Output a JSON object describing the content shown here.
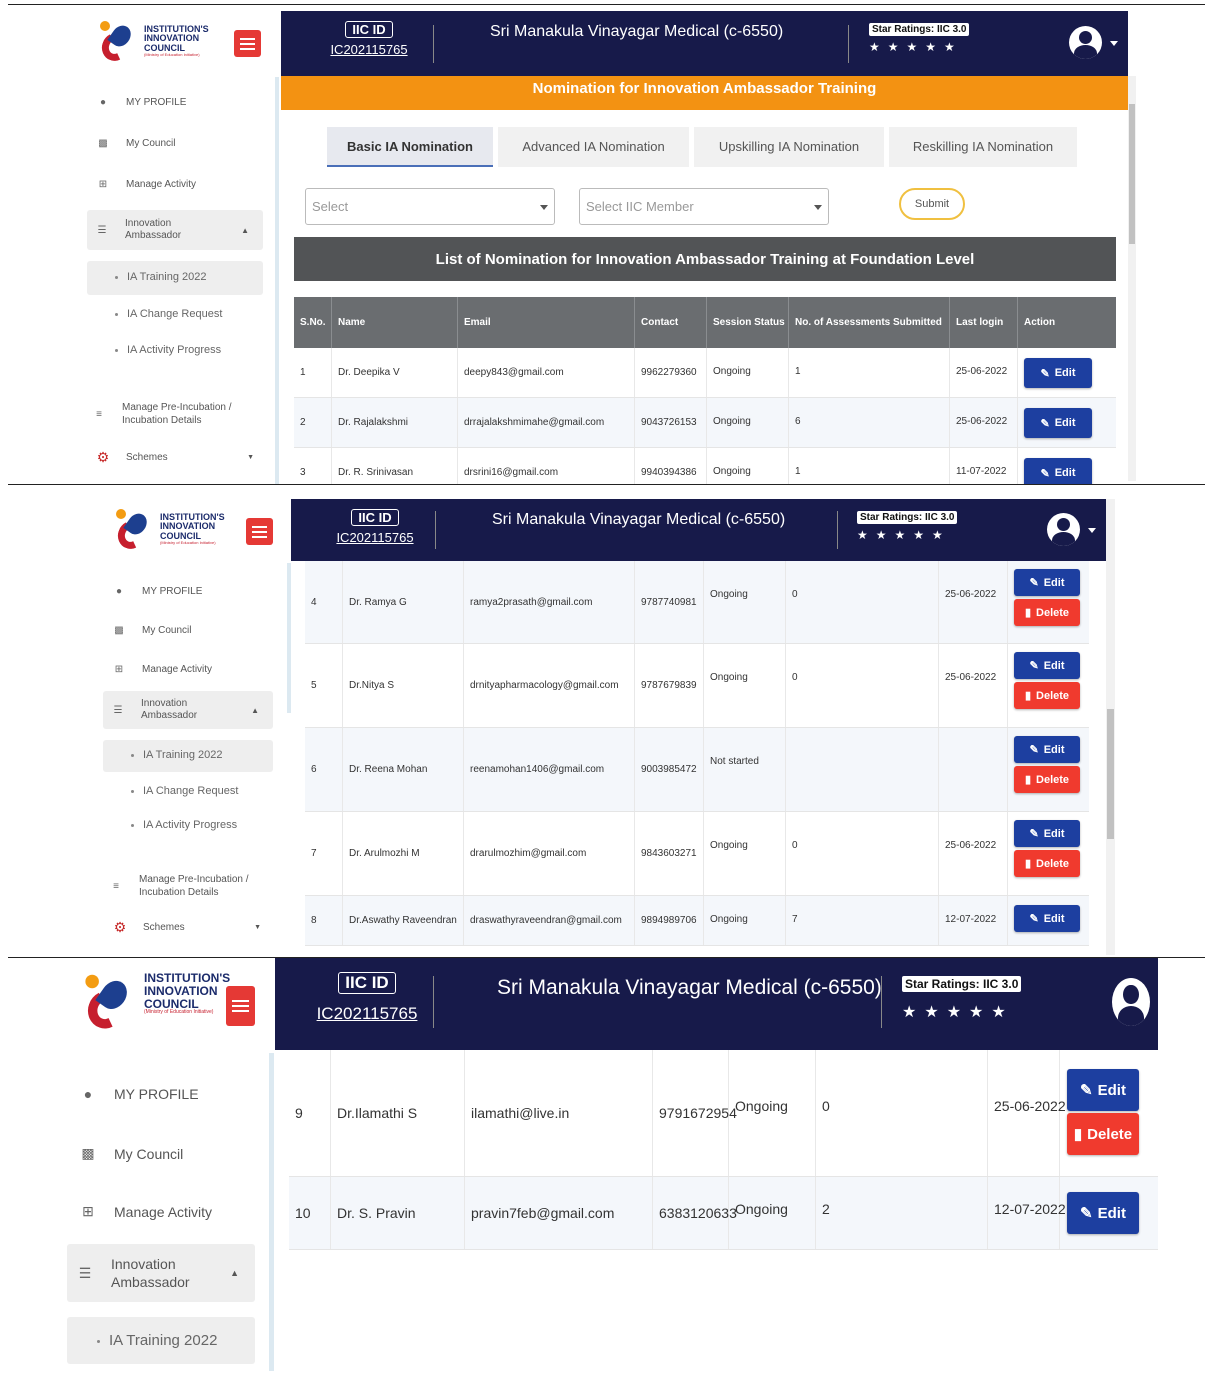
{
  "app": {
    "logo_line1": "INSTITUTION'S",
    "logo_line2": "INNOVATION",
    "logo_line3": "COUNCIL",
    "logo_line4": "(Ministry of Education Initiative)",
    "iic_id_tag": "IIC ID",
    "iic_id": "IC202115765",
    "institution": "Sri Manakula Vinayagar Medical (c-6550)",
    "rating_label": "Star Ratings: IIC 3.0",
    "stars": "★★★★★"
  },
  "sidebar": {
    "my_profile": "MY PROFILE",
    "my_council": "My Council",
    "manage_activity": "Manage Activity",
    "innovation_ambassador": "Innovation Ambassador",
    "ia_training": "IA Training 2022",
    "ia_change_request": "IA Change Request",
    "ia_activity_progress": "IA Activity Progress",
    "pre_incubation": "Manage Pre-Incubation / Incubation Details",
    "schemes": "Schemes"
  },
  "banner": "Nomination for Innovation Ambassador Training",
  "tabs": [
    "Basic IA Nomination",
    "Advanced IA Nomination",
    "Upskilling IA Nomination",
    "Reskilling IA Nomination"
  ],
  "form": {
    "select_placeholder": "Select",
    "member_placeholder": "Select IIC Member",
    "submit": "Submit"
  },
  "table_title": "List of Nomination for Innovation Ambassador Training at Foundation Level",
  "columns": [
    "S.No.",
    "Name",
    "Email",
    "Contact",
    "Session Status",
    "No. of Assessments Submitted",
    "Last login",
    "Action"
  ],
  "buttons": {
    "edit": "Edit",
    "delete": "Delete"
  },
  "rows": [
    {
      "sno": "1",
      "name": "Dr. Deepika V",
      "email": "deepy843@gmail.com",
      "contact": "9962279360",
      "status": "Ongoing",
      "assess": "1",
      "login": "25-06-2022"
    },
    {
      "sno": "2",
      "name": "Dr. Rajalakshmi",
      "email": "drrajalakshmimahe@gmail.com",
      "contact": "9043726153",
      "status": "Ongoing",
      "assess": "6",
      "login": "25-06-2022"
    },
    {
      "sno": "3",
      "name": "Dr. R. Srinivasan",
      "email": "drsrini16@gmail.com",
      "contact": "9940394386",
      "status": "Ongoing",
      "assess": "1",
      "login": "11-07-2022"
    },
    {
      "sno": "4",
      "name": "Dr. Ramya G",
      "email": "ramya2prasath@gmail.com",
      "contact": "9787740981",
      "status": "Ongoing",
      "assess": "0",
      "login": "25-06-2022"
    },
    {
      "sno": "5",
      "name": "Dr.Nitya S",
      "email": "drnityapharmacology@gmail.com",
      "contact": "9787679839",
      "status": "Ongoing",
      "assess": "0",
      "login": "25-06-2022"
    },
    {
      "sno": "6",
      "name": "Dr. Reena Mohan",
      "email": "reenamohan1406@gmail.com",
      "contact": "9003985472",
      "status": "Not started",
      "assess": "",
      "login": ""
    },
    {
      "sno": "7",
      "name": "Dr. Arulmozhi M",
      "email": "drarulmozhim@gmail.com",
      "contact": "9843603271",
      "status": "Ongoing",
      "assess": "0",
      "login": "25-06-2022"
    },
    {
      "sno": "8",
      "name": "Dr.Aswathy Raveendran",
      "email": "draswathyraveendran@gmail.com",
      "contact": "9894989706",
      "status": "Ongoing",
      "assess": "7",
      "login": "12-07-2022"
    },
    {
      "sno": "9",
      "name": "Dr.Ilamathi S",
      "email": "ilamathi@live.in",
      "contact": "9791672954",
      "status": "Ongoing",
      "assess": "0",
      "login": "25-06-2022"
    },
    {
      "sno": "10",
      "name": "Dr. S. Pravin",
      "email": "pravin7feb@gmail.com",
      "contact": "6383120633",
      "status": "Ongoing",
      "assess": "2",
      "login": "12-07-2022"
    }
  ],
  "colors": {
    "navy": "#171a4a",
    "orange": "#f39212",
    "edit": "#1d3fa0",
    "delete": "#f03a2e"
  },
  "icons": [
    "user-icon",
    "edit-square-icon",
    "grid-icon",
    "list-icon",
    "layers-icon",
    "gears-icon",
    "pencil-icon",
    "trash-icon",
    "avatar-icon",
    "hamburger-icon"
  ]
}
